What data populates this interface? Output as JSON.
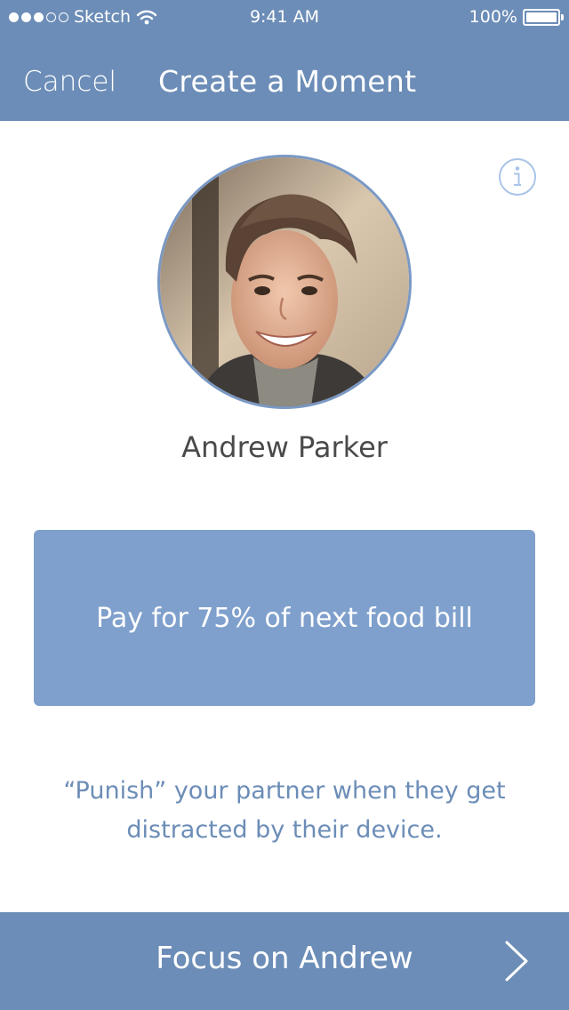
{
  "status_bar": {
    "carrier": "Sketch",
    "time": "9:41 AM",
    "battery": "100%",
    "signal_full": 3,
    "signal_total": 5
  },
  "nav": {
    "cancel_label": "Cancel",
    "title": "Create a Moment"
  },
  "profile": {
    "name": "Andrew Parker"
  },
  "moment": {
    "text": "Pay for 75% of next food bill"
  },
  "hint": {
    "text": "“Punish” your partner when they get distracted by their device."
  },
  "footer": {
    "button_label": "Focus on Andrew"
  },
  "colors": {
    "primary": "#6c8db7",
    "card": "#7fa0cc",
    "text_dark": "#4a4a4a",
    "info_icon": "#a9c4e8"
  },
  "icons": [
    "wifi-icon",
    "battery-icon",
    "info-icon",
    "chevron-right-icon"
  ]
}
